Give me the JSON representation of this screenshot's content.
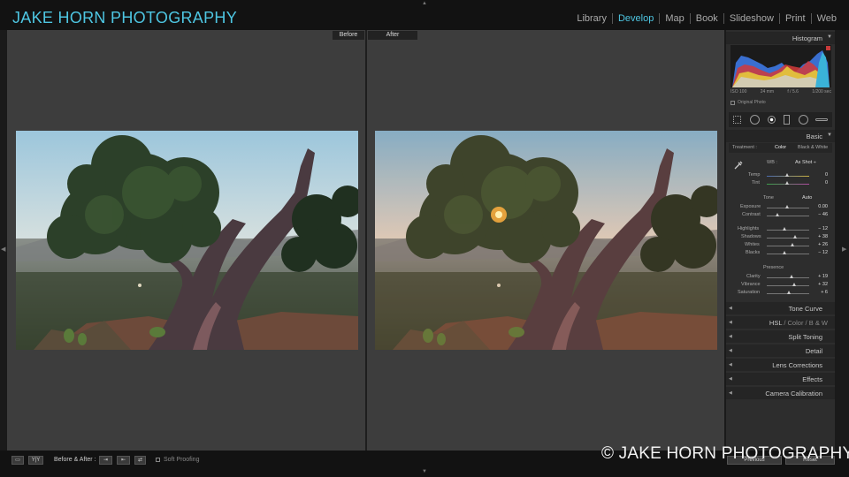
{
  "app": {
    "brand": "JAKE HORN PHOTOGRAPHY",
    "modules": [
      {
        "label": "Library",
        "active": false
      },
      {
        "label": "Develop",
        "active": true
      },
      {
        "label": "Map",
        "active": false
      },
      {
        "label": "Book",
        "active": false
      },
      {
        "label": "Slideshow",
        "active": false
      },
      {
        "label": "Print",
        "active": false
      },
      {
        "label": "Web",
        "active": false
      }
    ],
    "accent": "#4ec6e2"
  },
  "view": {
    "before_label": "Before",
    "after_label": "After"
  },
  "panel": {
    "histogram": {
      "title": "Histogram",
      "iso": "ISO 100",
      "focal": "24 mm",
      "aperture": "f / 5.6",
      "shutter": "1/200 sec",
      "original_photo": "Original Photo"
    },
    "basic": {
      "title": "Basic",
      "treatment_label": "Treatment :",
      "treatment_color": "Color",
      "treatment_bw": "Black & White",
      "wb_label": "WB :",
      "wb_value": "As Shot ÷",
      "temp_label": "Temp",
      "temp_value": "0",
      "tint_label": "Tint",
      "tint_value": "0",
      "tone_label": "Tone",
      "auto_label": "Auto",
      "exposure_label": "Exposure",
      "exposure_value": "0.00",
      "contrast_label": "Contrast",
      "contrast_value": "− 46",
      "highlights_label": "Highlights",
      "highlights_value": "− 12",
      "shadows_label": "Shadows",
      "shadows_value": "+ 38",
      "whites_label": "Whites",
      "whites_value": "+ 26",
      "blacks_label": "Blacks",
      "blacks_value": "− 12",
      "presence_label": "Presence",
      "clarity_label": "Clarity",
      "clarity_value": "+ 19",
      "vibrance_label": "Vibrance",
      "vibrance_value": "+ 32",
      "saturation_label": "Saturation",
      "saturation_value": "+ 6"
    },
    "sections": {
      "tone_curve": "Tone Curve",
      "hsl": "HSL",
      "hsl_sep1": "/",
      "hsl_color": "Color",
      "hsl_sep2": "/",
      "hsl_bw": "B & W",
      "split_toning": "Split Toning",
      "detail": "Detail",
      "lens_corrections": "Lens Corrections",
      "effects": "Effects",
      "camera_calibration": "Camera Calibration"
    }
  },
  "toolbar": {
    "before_after_label": "Before & After :",
    "view_mode": "Y|Y",
    "soft_proofing": "Soft Proofing",
    "previous": "Previous",
    "reset": "Reset"
  },
  "watermark": "© JAKE HORN PHOTOGRAPHY"
}
